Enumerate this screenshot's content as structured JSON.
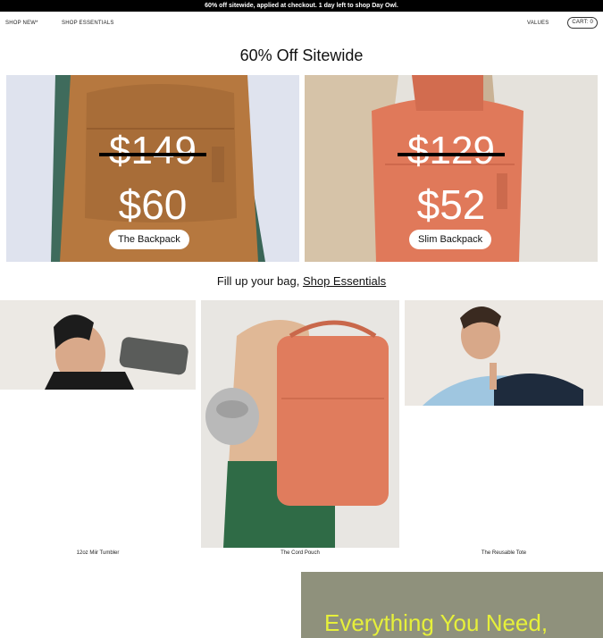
{
  "announcement": "60% off sitewide, applied at checkout. 1 day left to shop Day Owl.",
  "nav": {
    "shop_new": "SHOP NEW*",
    "shop_essentials": "SHOP ESSENTIALS",
    "values": "VALUES",
    "cart": "CART: 0"
  },
  "hero": {
    "headline": "60% Off Sitewide",
    "promos": [
      {
        "old_price": "$149",
        "new_price": "$60",
        "label": "The Backpack"
      },
      {
        "old_price": "$129",
        "new_price": "$52",
        "label": "Slim Backpack"
      }
    ]
  },
  "essentials": {
    "lead": "Fill up your bag, ",
    "link": "Shop Essentials",
    "products": [
      {
        "name": "12oz Miir Tumbler"
      },
      {
        "name": "The Cord Pouch"
      },
      {
        "name": "The Reusable Tote"
      }
    ]
  },
  "banner": {
    "text": "Everything You Need,"
  },
  "colors": {
    "backpack_tan": "#b6783f",
    "backpack_coral": "#e0795a",
    "banner_bg": "#8f917c",
    "banner_text": "#e6f03a"
  }
}
